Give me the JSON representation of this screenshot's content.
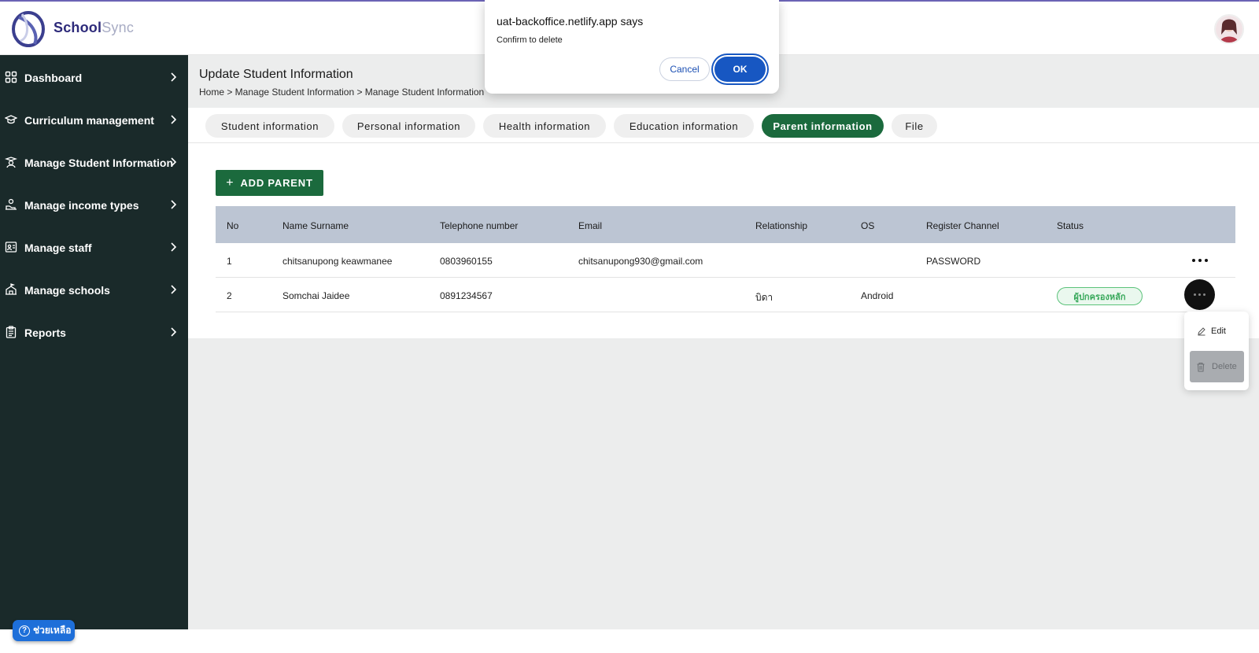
{
  "brand": {
    "name_part1": "School",
    "name_part2": "Sync"
  },
  "sidebar": {
    "items": [
      {
        "label": "Dashboard",
        "icon": "grid-icon"
      },
      {
        "label": "Curriculum management",
        "icon": "graduation-cap-icon"
      },
      {
        "label": "Manage Student Information",
        "icon": "student-icon"
      },
      {
        "label": "Manage income types",
        "icon": "money-hand-icon"
      },
      {
        "label": "Manage staff",
        "icon": "staff-board-icon"
      },
      {
        "label": "Manage schools",
        "icon": "school-icon"
      },
      {
        "label": "Reports",
        "icon": "clipboard-icon"
      }
    ],
    "help_label": "ช่วยเหลือ"
  },
  "page": {
    "title": "Update Student Information",
    "breadcrumb": "Home > Manage Student Information > Manage Student Information"
  },
  "tabs": [
    {
      "label": "Student information",
      "active": false
    },
    {
      "label": "Personal information",
      "active": false
    },
    {
      "label": "Health information",
      "active": false
    },
    {
      "label": "Education information",
      "active": false
    },
    {
      "label": "Parent information",
      "active": true
    },
    {
      "label": "File",
      "active": false
    }
  ],
  "add_button": {
    "label": "ADD PARENT"
  },
  "table": {
    "headers": [
      "No",
      "Name Surname",
      "Telephone number",
      "Email",
      "Relationship",
      "OS",
      "Register Channel",
      "Status"
    ],
    "rows": [
      {
        "no": "1",
        "name": "chitsanupong keawmanee",
        "phone": "0803960155",
        "email": "chitsanupong930@gmail.com",
        "relationship": "",
        "os": "",
        "channel": "PASSWORD",
        "status": ""
      },
      {
        "no": "2",
        "name": "Somchai Jaidee",
        "phone": "0891234567",
        "email": "",
        "relationship": "บิดา",
        "os": "Android",
        "channel": "",
        "status": "ผู้ปกครองหลัก"
      }
    ]
  },
  "row_menu": {
    "edit_label": "Edit",
    "delete_label": "Delete"
  },
  "dialog": {
    "title": "uat-backoffice.netlify.app says",
    "message": "Confirm to delete",
    "cancel_label": "Cancel",
    "ok_label": "OK"
  },
  "colors": {
    "sidebar_bg": "#1a2a2a",
    "accent_green": "#1b6a3d",
    "dialog_blue": "#1757c2",
    "header_row": "#bcc5d3"
  }
}
